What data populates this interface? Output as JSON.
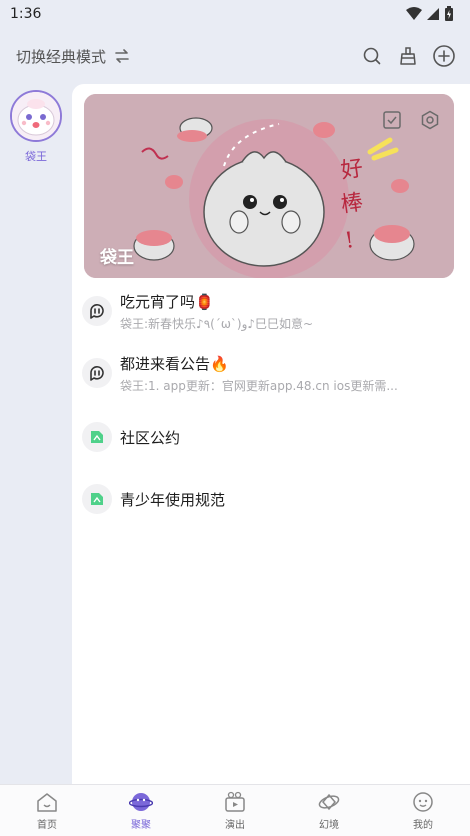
{
  "status_bar": {
    "time": "1:36",
    "icons": [
      "wifi-icon",
      "signal-icon",
      "battery-icon"
    ]
  },
  "header": {
    "mode_switch_label": "切换经典模式",
    "actions": [
      "search-icon",
      "broom-icon",
      "add-icon"
    ]
  },
  "sidebar": {
    "servers": [
      {
        "name": "袋王",
        "selected": true
      }
    ]
  },
  "banner": {
    "name": "袋王",
    "art_text": "好棒!"
  },
  "channels": [
    {
      "title": "吃元宵了吗",
      "emoji": "🏮",
      "subtitle": "袋王:新春快乐♪٩(´ω`)و♪巳巳如意~",
      "icon": "chat-channel-icon"
    },
    {
      "title": "都进来看公告",
      "emoji": "🔥",
      "subtitle": "袋王:1. app更新：官网更新app.48.cn   ios更新需...",
      "icon": "chat-channel-icon"
    },
    {
      "title": "社区公约",
      "emoji": "",
      "subtitle": "",
      "icon": "document-channel-icon"
    },
    {
      "title": "青少年使用规范",
      "emoji": "",
      "subtitle": "",
      "icon": "document-channel-icon"
    }
  ],
  "tabbar": {
    "tabs": [
      {
        "label": "首页",
        "icon": "home-icon",
        "active": false
      },
      {
        "label": "聚聚",
        "icon": "planet-icon",
        "active": true
      },
      {
        "label": "演出",
        "icon": "video-icon",
        "active": false
      },
      {
        "label": "幻境",
        "icon": "orbit-icon",
        "active": false
      },
      {
        "label": "我的",
        "icon": "profile-icon",
        "active": false
      }
    ]
  },
  "colors": {
    "accent": "#7b68d9",
    "background": "#e9ecf4",
    "banner": "#cfb0b8",
    "doc_icon": "#4fd18a"
  }
}
